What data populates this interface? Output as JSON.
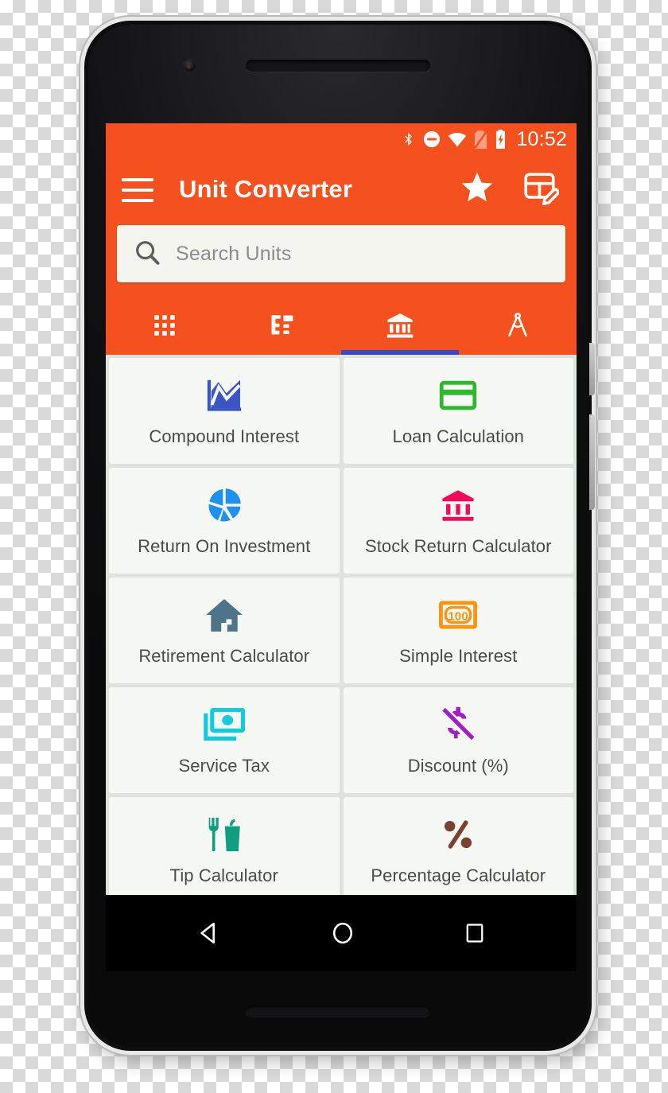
{
  "status_bar": {
    "clock": "10:52",
    "icons": [
      {
        "name": "bluetooth-icon",
        "label": "bluetooth"
      },
      {
        "name": "do-not-disturb-icon",
        "label": "do not disturb"
      },
      {
        "name": "wifi-icon",
        "label": "wifi"
      },
      {
        "name": "no-sim-icon",
        "label": "no sim"
      },
      {
        "name": "battery-charging-icon",
        "label": "battery charging"
      }
    ]
  },
  "app_bar": {
    "title": "Unit Converter",
    "menu_icon": "hamburger-menu-icon",
    "actions": [
      {
        "name": "favorites-star-button",
        "label": "Favorites"
      },
      {
        "name": "customize-grid-button",
        "label": "Customize"
      }
    ]
  },
  "search": {
    "placeholder": "Search Units",
    "value": "",
    "icon": "search-icon"
  },
  "tabs": [
    {
      "name": "tab-all-units",
      "icon": "apps-grid-icon",
      "active": false
    },
    {
      "name": "tab-categories",
      "icon": "tree-list-icon",
      "active": false
    },
    {
      "name": "tab-finance",
      "icon": "bank-icon",
      "active": true
    },
    {
      "name": "tab-tools",
      "icon": "compass-divider-icon",
      "active": false
    }
  ],
  "theme": {
    "primary": "#f4511e",
    "status_bar": "#f4511e",
    "tab_indicator": "#3949c4",
    "card_background": "#f6f9f3",
    "grid_background": "#dfe3dd",
    "label_color": "#4a4a4a",
    "placeholder_color": "#8c8c8c"
  },
  "grid_items": [
    {
      "label": "Compound Interest",
      "icon": "line-chart-icon",
      "color": "#3b56c4"
    },
    {
      "label": "Loan Calculation",
      "icon": "credit-card-icon",
      "color": "#2eb82e"
    },
    {
      "label": "Return On Investment",
      "icon": "pie-chart-icon",
      "color": "#1e90f0"
    },
    {
      "label": "Stock Return Calculator",
      "icon": "bank-icon",
      "color": "#ef0a5a"
    },
    {
      "label": "Retirement Calculator",
      "icon": "home-icon",
      "color": "#4d7488"
    },
    {
      "label": "Simple Interest",
      "icon": "banknote-100-icon",
      "color": "#fb9410"
    },
    {
      "label": "Service Tax",
      "icon": "cash-stack-icon",
      "color": "#12ccdd"
    },
    {
      "label": "Discount (%)",
      "icon": "money-off-icon",
      "color": "#a31ec4"
    },
    {
      "label": "Tip Calculator",
      "icon": "fork-and-drink-icon",
      "color": "#0f9e81"
    },
    {
      "label": "Percentage Calculator",
      "icon": "percent-icon",
      "color": "#7a4331"
    }
  ],
  "nav_bar": {
    "buttons": [
      {
        "name": "nav-back-button",
        "label": "Back"
      },
      {
        "name": "nav-home-button",
        "label": "Home"
      },
      {
        "name": "nav-recents-button",
        "label": "Recents"
      }
    ]
  }
}
